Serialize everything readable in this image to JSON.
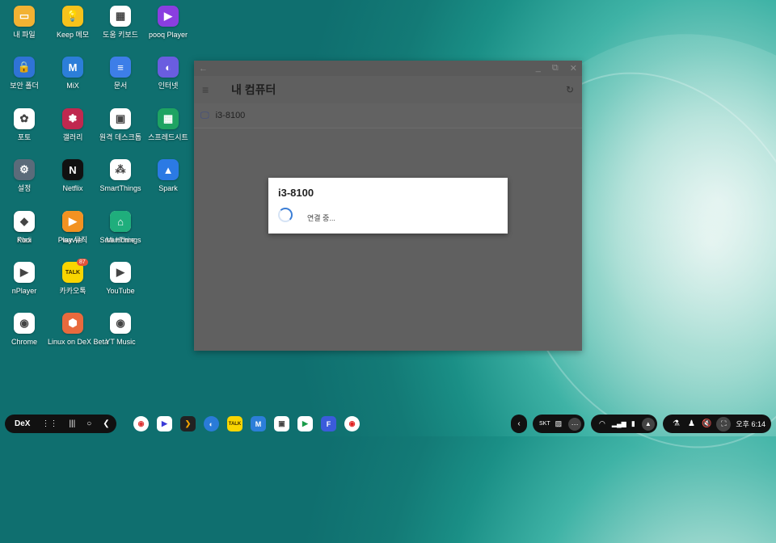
{
  "desktop": {
    "icons": [
      {
        "label": "내 파일",
        "color": "#f2b233",
        "glyph": "▭"
      },
      {
        "label": "Keep 메모",
        "color": "#f7c21b",
        "glyph": "💡"
      },
      {
        "label": "도움 키보드",
        "color": "#ffffff",
        "glyph": "▦"
      },
      {
        "label": "pooq Player",
        "color": "#8a3ee0",
        "glyph": "▶"
      },
      {
        "label": "보안 폴더",
        "color": "#2f73d6",
        "glyph": "🔒"
      },
      {
        "label": "MiX",
        "color": "#2c7ed9",
        "glyph": "M"
      },
      {
        "label": "문서",
        "color": "#3d7ee8",
        "glyph": "≡"
      },
      {
        "label": "인터넷",
        "color": "#6a5de0",
        "glyph": "◐"
      },
      {
        "label": "포토",
        "color": "#ffffff",
        "glyph": "✿"
      },
      {
        "label": "갤러리",
        "color": "#c0284f",
        "glyph": "✽"
      },
      {
        "label": "원격 데스크톱",
        "color": "#ffffff",
        "glyph": "▣"
      },
      {
        "label": "스프레드시트",
        "color": "#1ea362",
        "glyph": "▦"
      },
      {
        "label": "설정",
        "color": "#5b6b7a",
        "glyph": "⚙"
      },
      {
        "label": "Netflix",
        "color": "#111111",
        "glyph": "N"
      },
      {
        "label": "SmartThings",
        "color": "#ffffff",
        "glyph": "⁂"
      },
      {
        "label": "Spark",
        "color": "#2b7ae4",
        "glyph": "▲"
      },
      {
        "label": "Plex",
        "color": "#222222",
        "glyph": "❯"
      },
      {
        "label": "wavve",
        "color": "#ffffff",
        "glyph": "▶"
      },
      {
        "label": "SmartThings",
        "color": "#ffffff",
        "glyph": "○"
      },
      {
        "label": "Kodi",
        "color": "#ffffff",
        "glyph": "◆"
      },
      {
        "label": "Play 뮤직",
        "color": "#f29221",
        "glyph": "▶"
      },
      {
        "label": "Mi Home",
        "color": "#1fae7c",
        "glyph": "⌂"
      },
      {
        "label": "nPlayer",
        "color": "#ffffff",
        "glyph": "▶"
      },
      {
        "label": "카카오톡",
        "color": "#f9d500",
        "glyph": "TALK"
      },
      {
        "label": "YouTube",
        "color": "#ffffff",
        "glyph": "▶"
      },
      {
        "label": "Chrome",
        "color": "#ffffff",
        "glyph": "◉"
      },
      {
        "label": "Linux on DeX Beta",
        "color": "#e86a3d",
        "glyph": "⬢"
      },
      {
        "label": "YT Music",
        "color": "#ffffff",
        "glyph": "◉"
      }
    ]
  },
  "window": {
    "title": "내 컴퓨터",
    "items": [
      {
        "name": "i3-8100"
      }
    ]
  },
  "dialog": {
    "title": "i3-8100",
    "message": "연결 중..."
  },
  "taskbar": {
    "dex_label": "DeX",
    "carrier": "SKT",
    "time": "오후 6:14",
    "badge": "87"
  }
}
